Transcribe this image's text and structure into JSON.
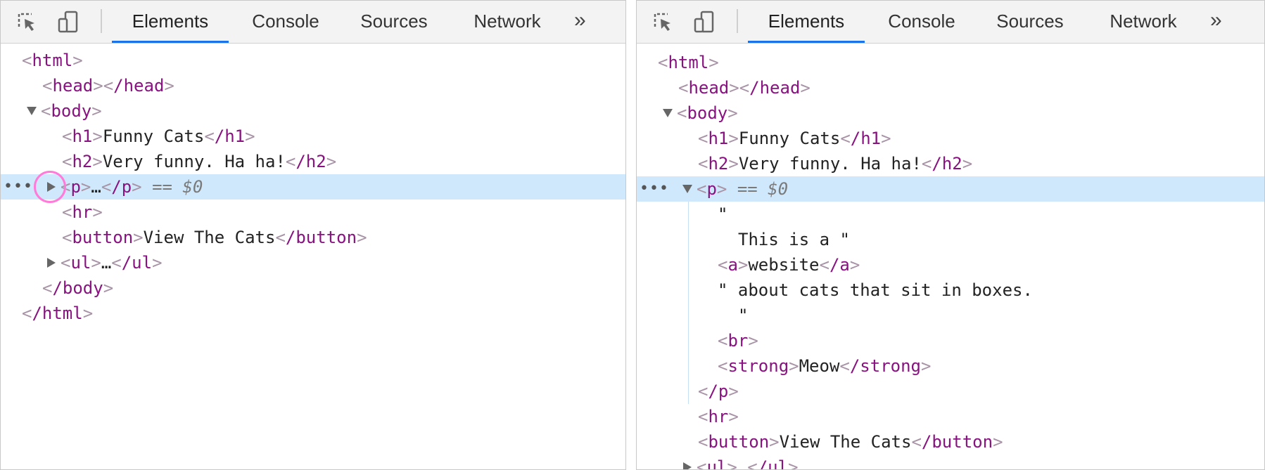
{
  "left_panel": {
    "tabs": [
      {
        "label": "Elements",
        "active": true
      },
      {
        "label": "Console",
        "active": false
      },
      {
        "label": "Sources",
        "active": false
      },
      {
        "label": "Network",
        "active": false
      }
    ],
    "more_label": "»",
    "dom": {
      "html_open": "html",
      "head_open": "head",
      "head_close": "/head",
      "body_open": "body",
      "h1_open": "h1",
      "h1_text": "Funny Cats",
      "h1_close": "/h1",
      "h2_open": "h2",
      "h2_text": "Very funny. Ha ha!",
      "h2_close": "/h2",
      "p_open": "p",
      "p_ellipsis": "…",
      "p_close": "/p",
      "selected_marker": "== $0",
      "row_dots": "•••",
      "hr": "hr",
      "button_open": "button",
      "button_text": "View The Cats",
      "button_close": "/button",
      "ul_open": "ul",
      "ul_ellipsis": "…",
      "ul_close": "/ul",
      "body_close": "/body",
      "html_close": "/html"
    }
  },
  "right_panel": {
    "tabs": [
      {
        "label": "Elements",
        "active": true
      },
      {
        "label": "Console",
        "active": false
      },
      {
        "label": "Sources",
        "active": false
      },
      {
        "label": "Network",
        "active": false
      }
    ],
    "more_label": "»",
    "dom": {
      "html_open": "html",
      "head_open": "head",
      "head_close": "/head",
      "body_open": "body",
      "h1_open": "h1",
      "h1_text": "Funny Cats",
      "h1_close": "/h1",
      "h2_open": "h2",
      "h2_text": "Very funny. Ha ha!",
      "h2_close": "/h2",
      "p_open": "p",
      "selected_marker": "== $0",
      "row_dots": "•••",
      "text_quote_open": "\"",
      "text_line_1": "This is a \"",
      "a_open": "a",
      "a_text": "website",
      "a_close": "/a",
      "text_line_2": "\" about cats that sit in boxes.",
      "text_quote_close": "\"",
      "br": "br",
      "strong_open": "strong",
      "strong_text": "Meow",
      "strong_close": "/strong",
      "p_close": "/p",
      "hr": "hr",
      "button_open": "button",
      "button_text": "View The Cats",
      "button_close": "/button",
      "ul_open": "ul",
      "ul_ellipsis": "…",
      "ul_close": "/ul"
    }
  },
  "icons": {
    "inspect": "inspect-element-icon",
    "device": "device-toolbar-icon",
    "expand": "triangle-right-icon",
    "collapse": "triangle-down-icon"
  },
  "colors": {
    "tag": "#881280",
    "punctuation": "#a894a6",
    "selected_row": "#cfe8fc",
    "active_tab_underline": "#1a73e8",
    "highlight_circle": "#ff7ad9"
  }
}
